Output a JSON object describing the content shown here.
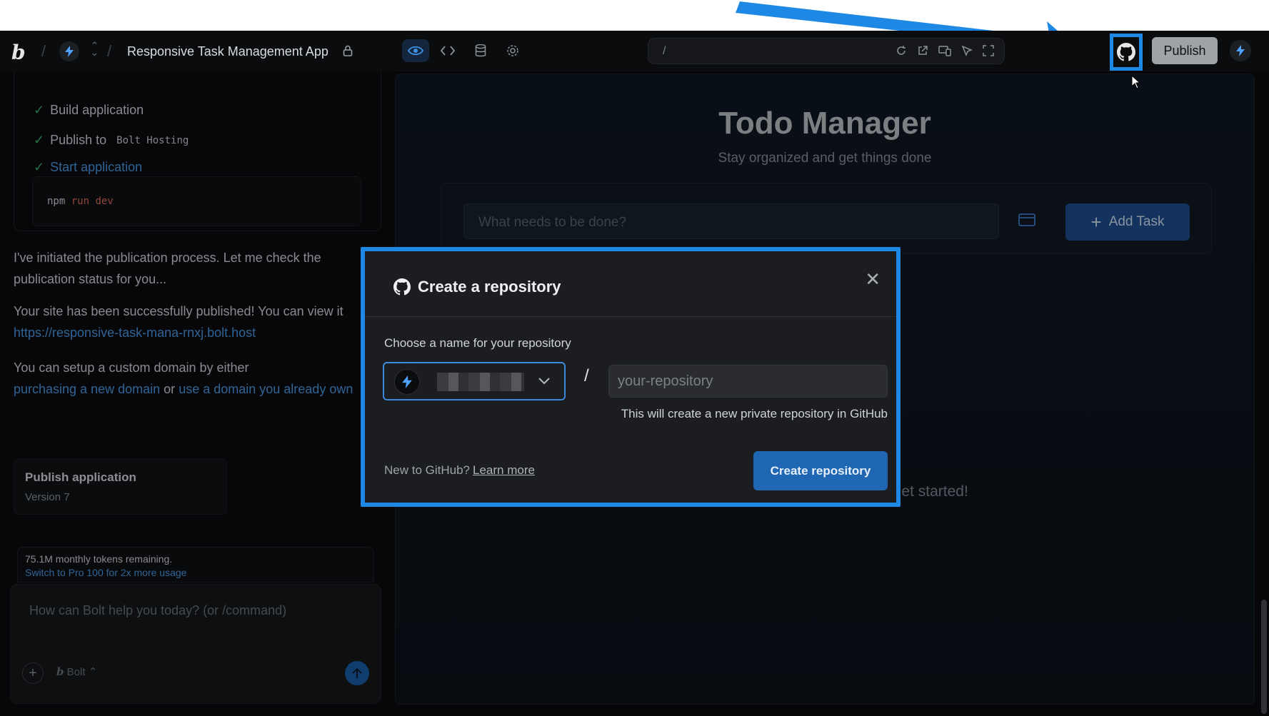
{
  "header": {
    "logo": "b",
    "project_title": "Responsive Task Management App",
    "url_path": "/",
    "publish_label": "Publish"
  },
  "steps": [
    {
      "label": "Build application",
      "code": ""
    },
    {
      "label": "Publish to",
      "code": "Bolt Hosting"
    },
    {
      "label": "Start application",
      "code": ""
    }
  ],
  "command": {
    "prefix": "npm",
    "rest": "run dev"
  },
  "messages": {
    "m1": "I've initiated the publication process. Let me check the publication status for you...",
    "m2_prefix": "Your site has been successfully published! You can view it",
    "m2_link": "https://responsive-task-mana-rnxj.bolt.host",
    "m3_prefix": "You can setup a custom domain by either",
    "m3_link1": "purchasing a new domain",
    "m3_or": "or",
    "m3_link2": "use a domain you already own"
  },
  "publish_card": {
    "title": "Publish application",
    "version": "Version 7"
  },
  "tokens": {
    "remaining": "75.1M monthly tokens remaining.",
    "upgrade": "Switch to Pro 100 for 2x more usage"
  },
  "chat": {
    "placeholder": "How can Bolt help you today? (or /command)",
    "model": "Bolt"
  },
  "preview": {
    "title": "Todo Manager",
    "subtitle": "Stay organized and get things done",
    "input_placeholder": "What needs to be done?",
    "add_label": "Add Task",
    "empty": "No tasks yet. Add one above to get started!"
  },
  "modal": {
    "title": "Create a repository",
    "label": "Choose a name for your repository",
    "slash": "/",
    "repo_placeholder": "your-repository",
    "note": "This will create a new private repository in GitHub",
    "new_prefix": "New to GitHub?",
    "learn": "Learn more",
    "create": "Create repository"
  },
  "colors": {
    "accent": "#1e88e5",
    "link": "#4b9ae8",
    "check": "#3fae6a"
  }
}
